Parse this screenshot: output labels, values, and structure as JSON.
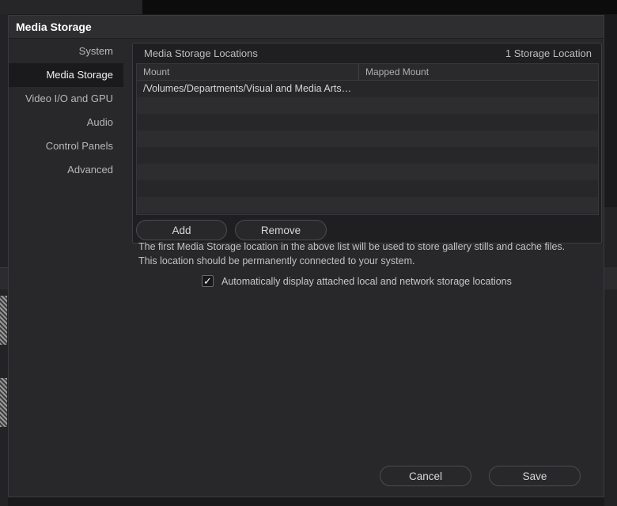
{
  "dialog": {
    "title": "Media Storage"
  },
  "sidebar": {
    "items": [
      {
        "label": "System",
        "active": false
      },
      {
        "label": "Media Storage",
        "active": true
      },
      {
        "label": "Video I/O and GPU",
        "active": false
      },
      {
        "label": "Audio",
        "active": false
      },
      {
        "label": "Control Panels",
        "active": false
      },
      {
        "label": "Advanced",
        "active": false
      }
    ]
  },
  "storage": {
    "section_title": "Media Storage Locations",
    "count_label": "1 Storage Location",
    "columns": {
      "mount": "Mount",
      "mapped_mount": "Mapped Mount"
    },
    "rows": [
      {
        "mount": "/Volumes/Departments/Visual and Media Arts…",
        "mapped_mount": ""
      }
    ],
    "add_label": "Add",
    "remove_label": "Remove"
  },
  "note": {
    "line1": "The first Media Storage location in the above list will be used to store gallery stills and cache files.",
    "line2": "This location should be permanently connected to your system."
  },
  "auto_display": {
    "checked": true,
    "label": "Automatically display attached local and network storage locations"
  },
  "footer": {
    "cancel_label": "Cancel",
    "save_label": "Save"
  },
  "colors": {
    "dialog_bg": "#28282b",
    "selected_nav_bg": "#1a1a1c"
  }
}
